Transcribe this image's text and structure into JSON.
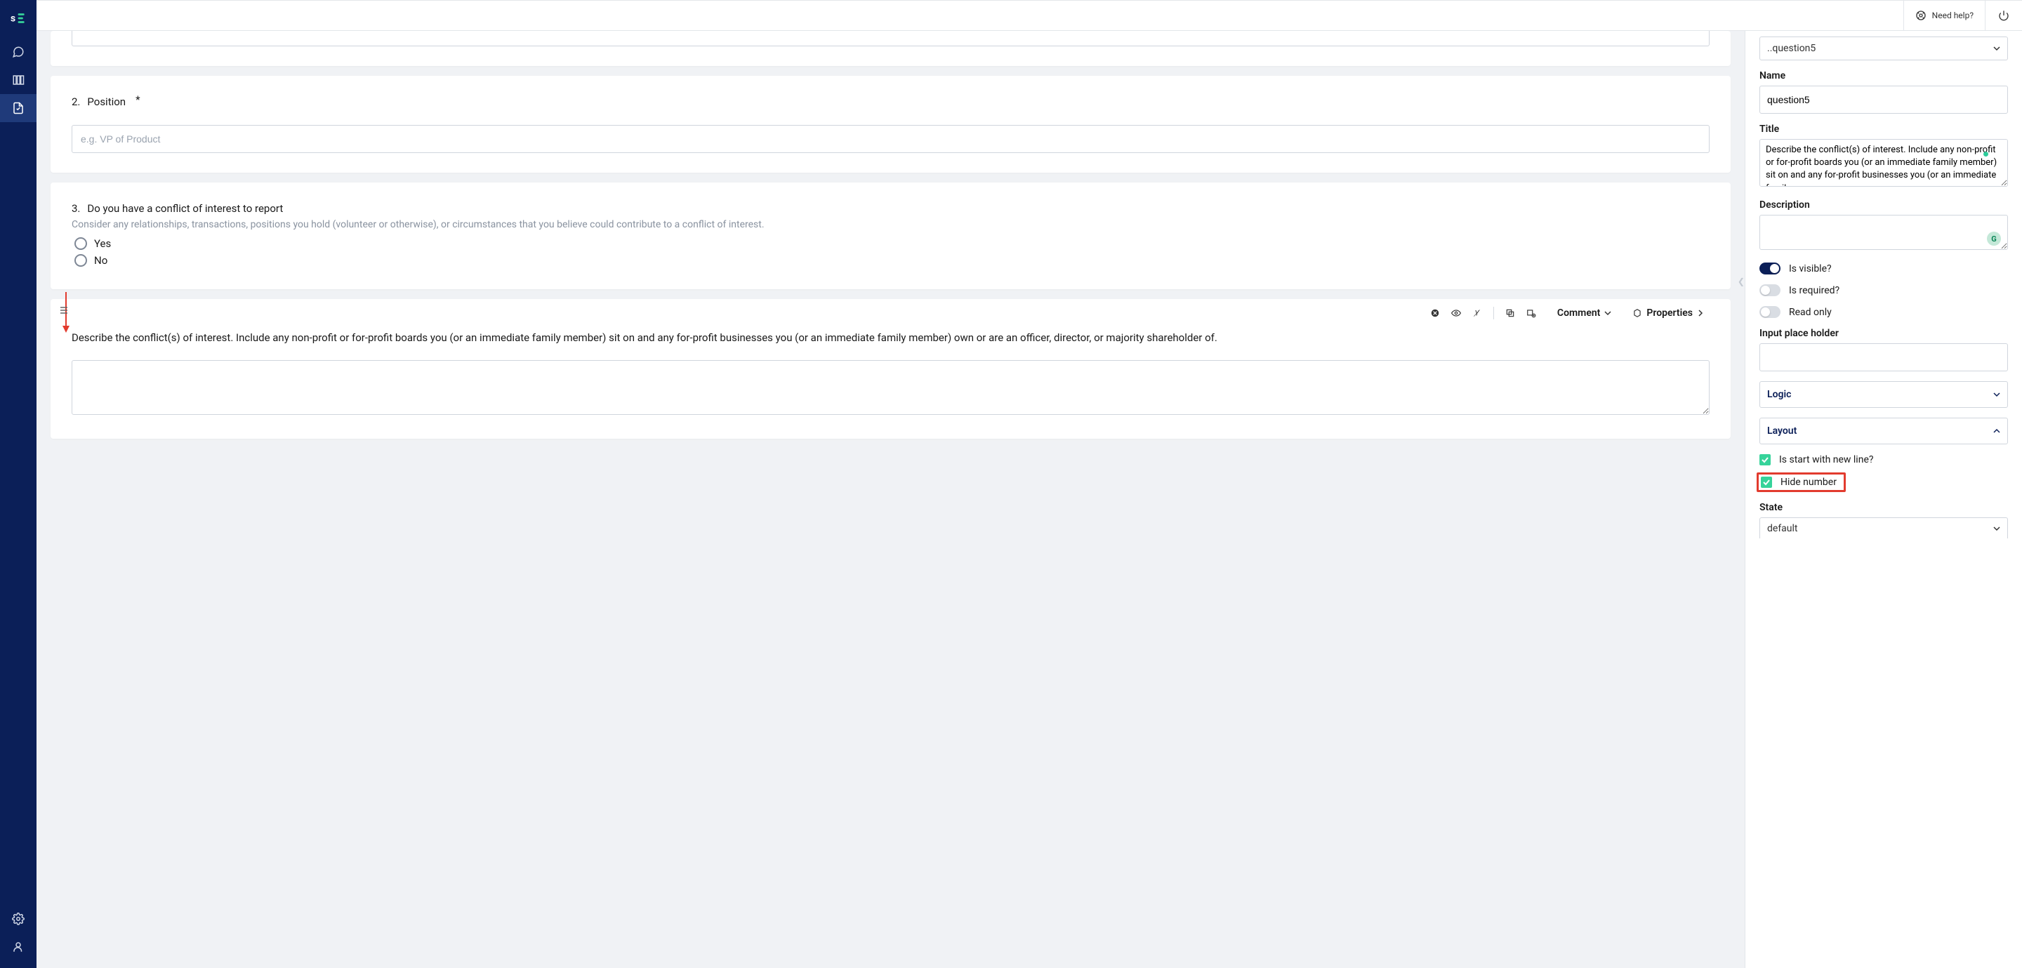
{
  "topbar": {
    "help_label": "Need help?"
  },
  "canvas": {
    "q2": {
      "number": "2.",
      "title": "Position",
      "placeholder": "e.g. VP of Product",
      "required_star": "*"
    },
    "q3": {
      "number": "3.",
      "title": "Do you have a conflict of interest to report",
      "description": "Consider any relationships, transactions, positions you hold (volunteer or otherwise), or circumstances that you believe could contribute to a conflict of interest.",
      "option_yes": "Yes",
      "option_no": "No"
    },
    "q5": {
      "toolbar": {
        "comment_label": "Comment",
        "properties_label": "Properties"
      },
      "text": "Describe the conflict(s) of interest. Include any non-profit or for-profit boards you (or an immediate family member) sit on and any for-profit businesses you (or an immediate family member) own or are an officer, director, or majority shareholder of."
    }
  },
  "panel": {
    "breadcrumb": "..question5",
    "name_label": "Name",
    "name_value": "question5",
    "title_label": "Title",
    "title_value": "Describe the conflict(s) of interest. Include any non-profit or for-profit boards you (or an immediate family member) sit on and any for-profit businesses you (or an immediate family",
    "description_label": "Description",
    "visible_label": "Is visible?",
    "required_label": "Is required?",
    "readonly_label": "Read only",
    "placeholder_label": "Input place holder",
    "logic_label": "Logic",
    "layout_label": "Layout",
    "start_newline_label": "Is start with new line?",
    "hide_number_label": "Hide number",
    "state_label": "State",
    "state_value": "default"
  }
}
